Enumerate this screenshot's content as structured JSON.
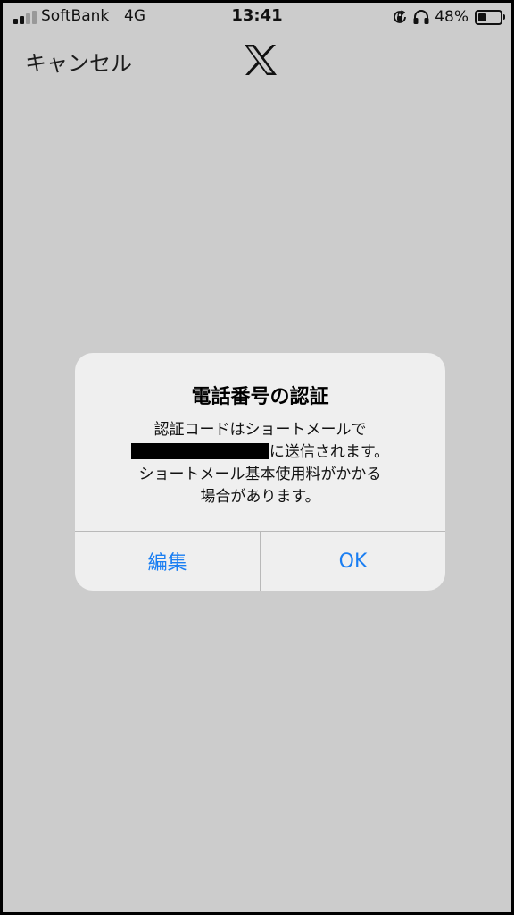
{
  "status_bar": {
    "carrier": "SoftBank",
    "network": "4G",
    "time": "13:41",
    "battery_percent": "48%",
    "battery_level": 0.48,
    "signal_bars": 2,
    "signal_total": 4,
    "icons": [
      "orientation-lock-icon",
      "headphones-icon",
      "battery-icon"
    ]
  },
  "nav": {
    "cancel_label": "キャンセル",
    "logo": "x-logo-icon"
  },
  "dialog": {
    "title": "電話番号の認証",
    "message_line1": "認証コードはショートメールで",
    "message_line2_suffix": "に送信されます。",
    "message_line3": "ショートメール基本使用料がかかる",
    "message_line4": "場合があります。",
    "edit_button": "編集",
    "ok_button": "OK",
    "button_color": "#1a7ef2"
  },
  "colors": {
    "overlay_background": "#cccccc",
    "dialog_background": "#efefef"
  }
}
